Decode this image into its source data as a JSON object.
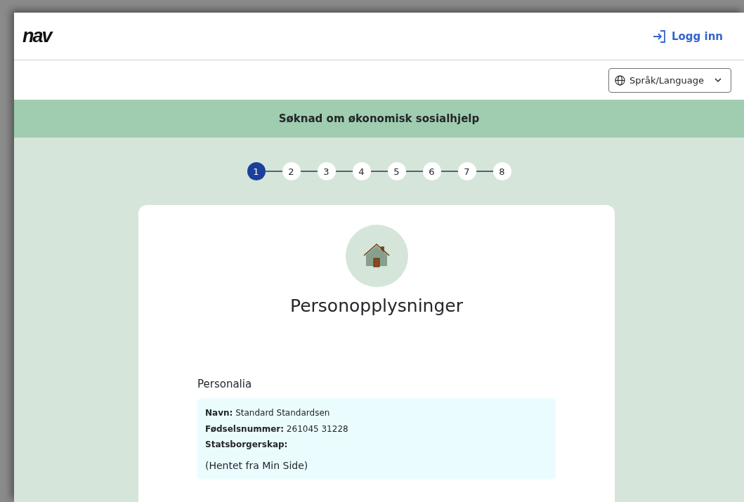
{
  "header": {
    "logo": "nav",
    "login": "Logg inn"
  },
  "language": {
    "label": "Språk/Language"
  },
  "banner": {
    "title": "Søknad om økonomisk sosialhjelp"
  },
  "steps": [
    {
      "label": "1",
      "selected": true
    },
    {
      "label": "2",
      "selected": false
    },
    {
      "label": "3",
      "selected": false
    },
    {
      "label": "4",
      "selected": false
    },
    {
      "label": "5",
      "selected": false
    },
    {
      "label": "6",
      "selected": false
    },
    {
      "label": "7",
      "selected": false
    },
    {
      "label": "8",
      "selected": false
    }
  ],
  "card": {
    "title": "Personopplysninger",
    "section": {
      "heading": "Personalia",
      "fields": [
        {
          "label": "Navn:",
          "value": "Standard Standardsen"
        },
        {
          "label": "Fødselsnummer:",
          "value": "261045 31228"
        },
        {
          "label": "Statsborgerskap:"
        }
      ],
      "source": "(Hentet fra Min Side)"
    }
  }
}
